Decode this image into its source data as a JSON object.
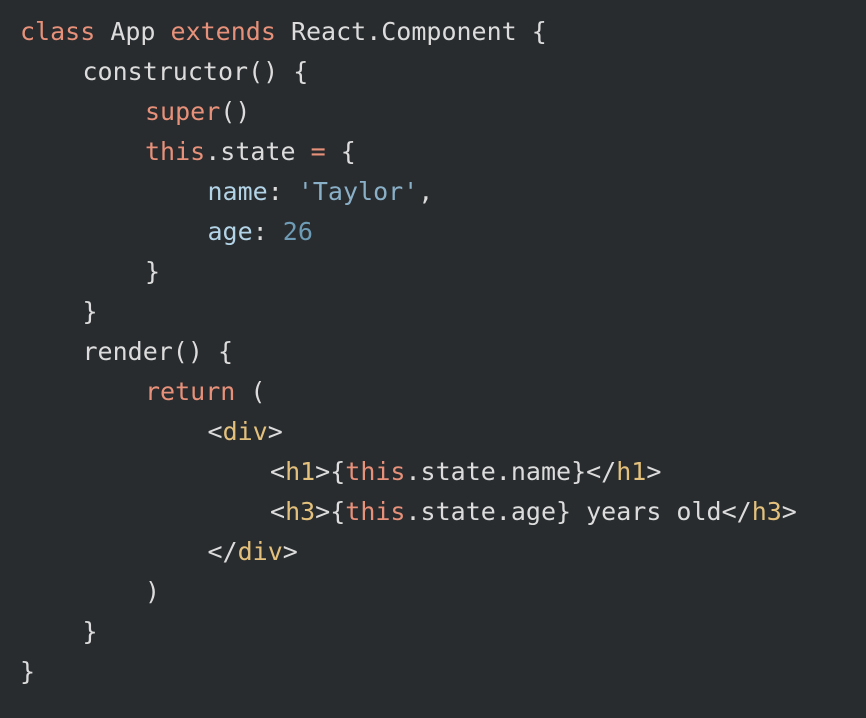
{
  "colors": {
    "background": "#282c2f",
    "plain": "#dcdcdc",
    "keyword": "#e8917a",
    "property": "#b3d3e6",
    "string": "#8ab0c8",
    "number": "#6e9cb6",
    "tag": "#e3c07c"
  },
  "code": {
    "lines": [
      {
        "indent": 0,
        "tokens": [
          {
            "t": "class",
            "k": "keyword"
          },
          {
            "t": " App ",
            "k": "plain"
          },
          {
            "t": "extends",
            "k": "keyword"
          },
          {
            "t": " React.Component {",
            "k": "plain"
          }
        ]
      },
      {
        "indent": 1,
        "tokens": [
          {
            "t": "constructor() {",
            "k": "plain"
          }
        ]
      },
      {
        "indent": 2,
        "tokens": [
          {
            "t": "super",
            "k": "keyword"
          },
          {
            "t": "()",
            "k": "plain"
          }
        ]
      },
      {
        "indent": 2,
        "tokens": [
          {
            "t": "this",
            "k": "keyword"
          },
          {
            "t": ".state ",
            "k": "plain"
          },
          {
            "t": "=",
            "k": "keyword"
          },
          {
            "t": " {",
            "k": "plain"
          }
        ]
      },
      {
        "indent": 3,
        "tokens": [
          {
            "t": "name",
            "k": "property"
          },
          {
            "t": ": ",
            "k": "plain"
          },
          {
            "t": "'Taylor'",
            "k": "string"
          },
          {
            "t": ",",
            "k": "plain"
          }
        ]
      },
      {
        "indent": 3,
        "tokens": [
          {
            "t": "age",
            "k": "property"
          },
          {
            "t": ": ",
            "k": "plain"
          },
          {
            "t": "26",
            "k": "number"
          }
        ]
      },
      {
        "indent": 2,
        "tokens": [
          {
            "t": "}",
            "k": "plain"
          }
        ]
      },
      {
        "indent": 1,
        "tokens": [
          {
            "t": "}",
            "k": "plain"
          }
        ]
      },
      {
        "indent": 1,
        "tokens": [
          {
            "t": "render() {",
            "k": "plain"
          }
        ]
      },
      {
        "indent": 2,
        "tokens": [
          {
            "t": "return",
            "k": "keyword"
          },
          {
            "t": " (",
            "k": "plain"
          }
        ]
      },
      {
        "indent": 3,
        "tokens": [
          {
            "t": "<",
            "k": "plain"
          },
          {
            "t": "div",
            "k": "tag"
          },
          {
            "t": ">",
            "k": "plain"
          }
        ]
      },
      {
        "indent": 4,
        "tokens": [
          {
            "t": "<",
            "k": "plain"
          },
          {
            "t": "h1",
            "k": "tag"
          },
          {
            "t": ">{",
            "k": "plain"
          },
          {
            "t": "this",
            "k": "keyword"
          },
          {
            "t": ".state.name}</",
            "k": "plain"
          },
          {
            "t": "h1",
            "k": "tag"
          },
          {
            "t": ">",
            "k": "plain"
          }
        ]
      },
      {
        "indent": 4,
        "tokens": [
          {
            "t": "<",
            "k": "plain"
          },
          {
            "t": "h3",
            "k": "tag"
          },
          {
            "t": ">{",
            "k": "plain"
          },
          {
            "t": "this",
            "k": "keyword"
          },
          {
            "t": ".state.age} years old</",
            "k": "plain"
          },
          {
            "t": "h3",
            "k": "tag"
          },
          {
            "t": ">",
            "k": "plain"
          }
        ]
      },
      {
        "indent": 3,
        "tokens": [
          {
            "t": "</",
            "k": "plain"
          },
          {
            "t": "div",
            "k": "tag"
          },
          {
            "t": ">",
            "k": "plain"
          }
        ]
      },
      {
        "indent": 2,
        "tokens": [
          {
            "t": ")",
            "k": "plain"
          }
        ]
      },
      {
        "indent": 1,
        "tokens": [
          {
            "t": "}",
            "k": "plain"
          }
        ]
      },
      {
        "indent": 0,
        "tokens": [
          {
            "t": "}",
            "k": "plain"
          }
        ]
      }
    ]
  }
}
